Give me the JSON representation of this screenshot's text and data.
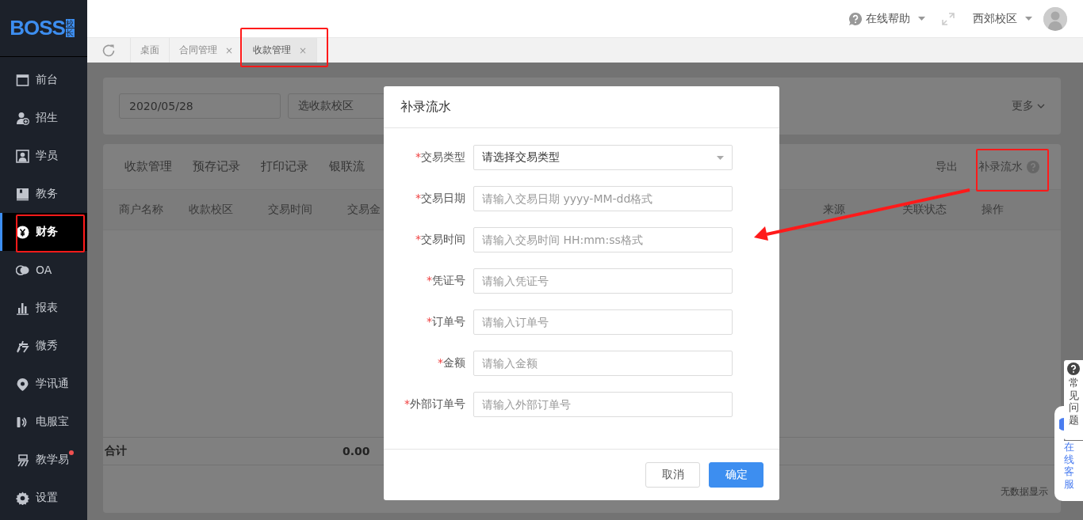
{
  "logo": {
    "text": "BOSS",
    "badge": [
      "校",
      "长"
    ]
  },
  "sidebar": {
    "items": [
      {
        "label": "前台",
        "selected": false,
        "dot": false
      },
      {
        "label": "招生",
        "selected": false,
        "dot": false
      },
      {
        "label": "学员",
        "selected": false,
        "dot": false
      },
      {
        "label": "教务",
        "selected": false,
        "dot": false
      },
      {
        "label": "财务",
        "selected": true,
        "dot": false
      },
      {
        "label": "OA",
        "selected": false,
        "dot": false
      },
      {
        "label": "报表",
        "selected": false,
        "dot": false
      },
      {
        "label": "微秀",
        "selected": false,
        "dot": false
      },
      {
        "label": "学讯通",
        "selected": false,
        "dot": false
      },
      {
        "label": "电服宝",
        "selected": false,
        "dot": false
      },
      {
        "label": "教学易",
        "selected": false,
        "dot": true
      },
      {
        "label": "设置",
        "selected": false,
        "dot": false
      }
    ]
  },
  "topbar": {
    "help": "在线帮助",
    "campus": "西郊校区"
  },
  "tabs": [
    {
      "label": "桌面",
      "selected": false
    },
    {
      "label": "合同管理",
      "close": "×",
      "selected": false
    },
    {
      "label": "收款管理",
      "close": "×",
      "selected": true
    }
  ],
  "filters": {
    "date": "2020/05/28",
    "campus_placeholder": "选收款校区",
    "more": "更多"
  },
  "subtabs": [
    "收款管理",
    "预存记录",
    "打印记录",
    "银联流"
  ],
  "actions": {
    "export": "导出",
    "add_record": "补录流水"
  },
  "table": {
    "columns": [
      "商户名称",
      "收款校区",
      "交易时间",
      "交易金",
      "来源",
      "关联状态",
      "操作"
    ],
    "totals": {
      "label": "合计",
      "amount": "0.00"
    },
    "empty": "无数据显示"
  },
  "modal": {
    "title": "补录流水",
    "fields": [
      {
        "label": "交易类型",
        "required_mark": "*",
        "kind": "select",
        "placeholder": "请选择交易类型"
      },
      {
        "label": "交易日期",
        "required_mark": "*",
        "kind": "input",
        "placeholder": "请输入交易日期 yyyy-MM-dd格式"
      },
      {
        "label": "交易时间",
        "required_mark": "*",
        "kind": "input",
        "placeholder": "请输入交易时间 HH:mm:ss格式"
      },
      {
        "label": "凭证号",
        "required_mark": "*",
        "kind": "input",
        "placeholder": "请输入凭证号"
      },
      {
        "label": "订单号",
        "required_mark": "*",
        "kind": "input",
        "placeholder": "请输入订单号"
      },
      {
        "label": "金额",
        "required_mark": "*",
        "kind": "input",
        "placeholder": "请输入金额"
      },
      {
        "label": "外部订单号",
        "required_mark": "*",
        "kind": "input",
        "placeholder": "请输入外部订单号"
      }
    ],
    "buttons": [
      {
        "label": "取消",
        "kind": "default"
      },
      {
        "label": "确定",
        "kind": "primary"
      }
    ]
  },
  "float": {
    "faq": "常见问题",
    "service": "在线客服"
  }
}
